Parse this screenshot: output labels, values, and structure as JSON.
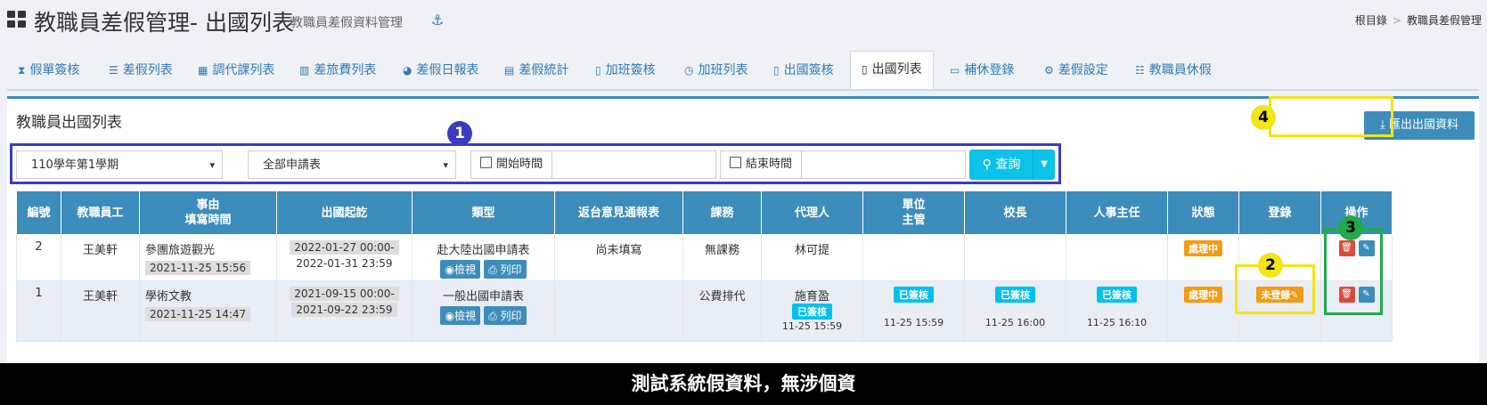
{
  "header": {
    "title": "教職員差假管理- 出國列表",
    "subtitle": "教職員差假資料管理",
    "breadcrumb": [
      "根目錄",
      "教職員差假管理"
    ]
  },
  "tabs": [
    {
      "label": "假單簽核",
      "icon": "hourglass-icon"
    },
    {
      "label": "差假列表",
      "icon": "list-icon"
    },
    {
      "label": "調代課列表",
      "icon": "table-icon"
    },
    {
      "label": "差旅費列表",
      "icon": "bar-chart-icon"
    },
    {
      "label": "差假日報表",
      "icon": "pie-chart-icon"
    },
    {
      "label": "差假統計",
      "icon": "calculator-icon"
    },
    {
      "label": "加班簽核",
      "icon": "file-icon"
    },
    {
      "label": "加班列表",
      "icon": "clock-icon"
    },
    {
      "label": "出國簽核",
      "icon": "file-text-icon"
    },
    {
      "label": "出國列表",
      "icon": "file-text-icon",
      "active": true
    },
    {
      "label": "補休登錄",
      "icon": "credit-card-icon"
    },
    {
      "label": "差假設定",
      "icon": "cogs-icon"
    },
    {
      "label": "教職員休假",
      "icon": "sliders-icon"
    }
  ],
  "panel": {
    "title": "教職員出國列表",
    "export_label": "匯出出國資料"
  },
  "filters": {
    "semester": "110學年第1學期",
    "form_type": "全部申請表",
    "start_label": "開始時間",
    "end_label": "結束時間",
    "query_label": "查詢"
  },
  "table": {
    "headers": {
      "no": "編號",
      "staff": "教職員工",
      "reason": "事由",
      "reason_sub": "填寫時間",
      "period": "出國起訖",
      "type": "類型",
      "report": "返台意見通報表",
      "course": "課務",
      "agent": "代理人",
      "unit": "單位",
      "unit_sub": "主管",
      "principal": "校長",
      "hr": "人事主任",
      "status": "狀態",
      "register": "登錄",
      "ops": "操作"
    },
    "view_label": "檢視",
    "print_label": "列印",
    "rows": [
      {
        "no": "2",
        "staff": "王美軒",
        "reason": "參團旅遊觀光",
        "filled": "2021-11-25 15:56",
        "period_start": "2022-01-27 00:00-",
        "period_end": "2022-01-31 23:59",
        "type": "赴大陸出國申請表",
        "report": "尚未填寫",
        "course": "無課務",
        "agent": "林可提",
        "status": "處理中"
      },
      {
        "no": "1",
        "staff": "王美軒",
        "reason": "學術文教",
        "filled": "2021-11-25 14:47",
        "period_start": "2021-09-15 00:00-",
        "period_end": "2021-09-22 23:59",
        "type": "一般出國申請表",
        "report": "",
        "course": "公費排代",
        "agent": "施育盈",
        "agent_badge": "已簽核",
        "agent_time": "11-25 15:59",
        "unit_badge": "已簽核",
        "unit_time": "11-25 15:59",
        "principal_badge": "已簽核",
        "principal_time": "11-25 16:00",
        "hr_badge": "已簽核",
        "hr_time": "11-25 16:10",
        "status": "處理中",
        "register": "未登錄"
      }
    ]
  },
  "annotations": {
    "markers": [
      "1",
      "2",
      "3",
      "4"
    ],
    "colors": {
      "m1": "#3b3bc4",
      "m2": "#f5e416",
      "m3": "#22a94a",
      "m4": "#f5e416"
    }
  },
  "footer": {
    "caption": "測試系統假資料，無涉個資"
  }
}
